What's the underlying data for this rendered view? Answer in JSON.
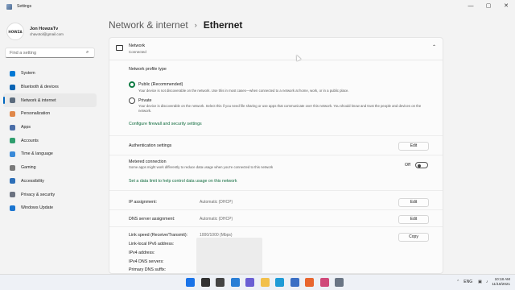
{
  "window": {
    "title": "Settings",
    "controls": [
      "—",
      "▢",
      "✕"
    ]
  },
  "user": {
    "name": "Jon HowzaTv",
    "email": "chavotol@gmail.com",
    "avatar_text": "HOWZA"
  },
  "search": {
    "placeholder": "Find a setting"
  },
  "nav": [
    {
      "label": "System",
      "icon": "system-icon",
      "color": "#0078d4"
    },
    {
      "label": "Bluetooth & devices",
      "icon": "bluetooth-icon",
      "color": "#0a64b4"
    },
    {
      "label": "Network & internet",
      "icon": "network-icon",
      "color": "#5b6b7d"
    },
    {
      "label": "Personalization",
      "icon": "brush-icon",
      "color": "#e0884a"
    },
    {
      "label": "Apps",
      "icon": "apps-icon",
      "color": "#4a6ea8"
    },
    {
      "label": "Accounts",
      "icon": "accounts-icon",
      "color": "#2f9e6e"
    },
    {
      "label": "Time & language",
      "icon": "clock-icon",
      "color": "#3a8ad8"
    },
    {
      "label": "Gaming",
      "icon": "gaming-icon",
      "color": "#7a7a7a"
    },
    {
      "label": "Accessibility",
      "icon": "accessibility-icon",
      "color": "#2d6fb8"
    },
    {
      "label": "Privacy & security",
      "icon": "shield-icon",
      "color": "#6b7280"
    },
    {
      "label": "Windows Update",
      "icon": "update-icon",
      "color": "#1b75d0"
    }
  ],
  "breadcrumb": {
    "parent": "Network & internet",
    "separator": "›",
    "current": "Ethernet"
  },
  "network": {
    "title": "Network",
    "status": "Connected",
    "profile_heading": "Network profile type",
    "public_label": "Public (Recommended)",
    "public_desc": "Your device is not discoverable on the network. Use this in most cases—when connected to a network at home, work, or in a public place.",
    "private_label": "Private",
    "private_desc": "Your device is discoverable on the network. Select this if you need file sharing or use apps that communicate over this network. You should know and trust the people and devices on the network.",
    "firewall_link": "Configure firewall and security settings",
    "auth_label": "Authentication settings",
    "auth_button": "Edit",
    "metered_label": "Metered connection",
    "metered_desc": "Some apps might work differently to reduce data usage when you're connected to this network",
    "metered_state": "Off",
    "data_limit_link": "Set a data limit to help control data usage on this network",
    "ip_label": "IP assignment:",
    "ip_value": "Automatic (DHCP)",
    "ip_button": "Edit",
    "dns_label": "DNS server assignment:",
    "dns_value": "Automatic (DHCP)",
    "dns_button": "Edit",
    "link_speed_label": "Link speed (Receive/Transmit):",
    "link_speed_value": "1000/1000 (Mbps)",
    "copy_button": "Copy",
    "ipv6_label": "Link-local IPv6 address:",
    "ipv4_label": "IPv4 address:",
    "ipv4dns_label": "IPv4 DNS servers:",
    "primary_dns_label": "Primary DNS suffix:"
  },
  "taskbar": {
    "apps": [
      {
        "name": "start-icon",
        "color": "#1a73e8"
      },
      {
        "name": "search-icon",
        "color": "#333333"
      },
      {
        "name": "task-view-icon",
        "color": "#444444"
      },
      {
        "name": "widgets-icon",
        "color": "#2a7fd6"
      },
      {
        "name": "chat-icon",
        "color": "#6b5fd3"
      },
      {
        "name": "file-explorer-icon",
        "color": "#f2c04c"
      },
      {
        "name": "edge-icon",
        "color": "#1f9bd6"
      },
      {
        "name": "store-icon",
        "color": "#3b6fc4"
      },
      {
        "name": "firefox-icon",
        "color": "#e8662f"
      },
      {
        "name": "app-icon",
        "color": "#d04a7a"
      },
      {
        "name": "settings-icon",
        "color": "#6a7584"
      }
    ],
    "language": "ENG",
    "time": "10:18 AM",
    "date": "11/18/2021"
  }
}
